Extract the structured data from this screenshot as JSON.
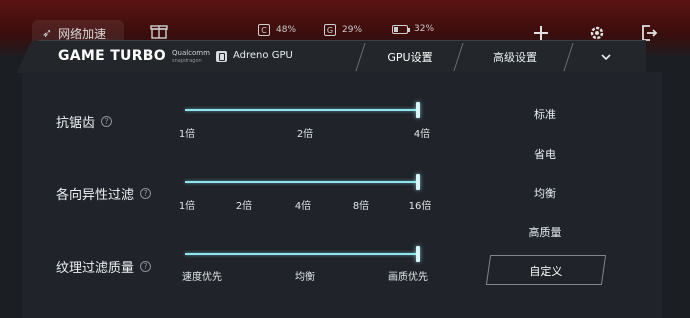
{
  "status_bar": {
    "network_boost_label": "网络加速",
    "cpu_usage": "48%",
    "gpu_usage": "29%",
    "battery": "32%"
  },
  "header": {
    "brand": "GAME TURBO",
    "chip_vendor": "Qualcomm",
    "chip_line": "snapdragon",
    "gpu_name": "Adreno GPU",
    "tabs": [
      {
        "label": "GPU设置",
        "active": true
      },
      {
        "label": "高级设置",
        "active": false
      }
    ]
  },
  "settings": [
    {
      "label": "抗锯齿",
      "ticks": [
        "1倍",
        "2倍",
        "4倍"
      ],
      "level_index": 2
    },
    {
      "label": "各向异性过滤",
      "ticks": [
        "1倍",
        "2倍",
        "4倍",
        "8倍",
        "16倍"
      ],
      "level_index": 4
    },
    {
      "label": "纹理过滤质量",
      "ticks": [
        "速度优先",
        "均衡",
        "画质优先"
      ],
      "level_index": 2
    }
  ],
  "presets": [
    "标准",
    "省电",
    "均衡",
    "高质量",
    "自定义"
  ],
  "selected_preset": "自定义",
  "colors": {
    "accent": "#8fe6ee",
    "background": "#20242a"
  }
}
